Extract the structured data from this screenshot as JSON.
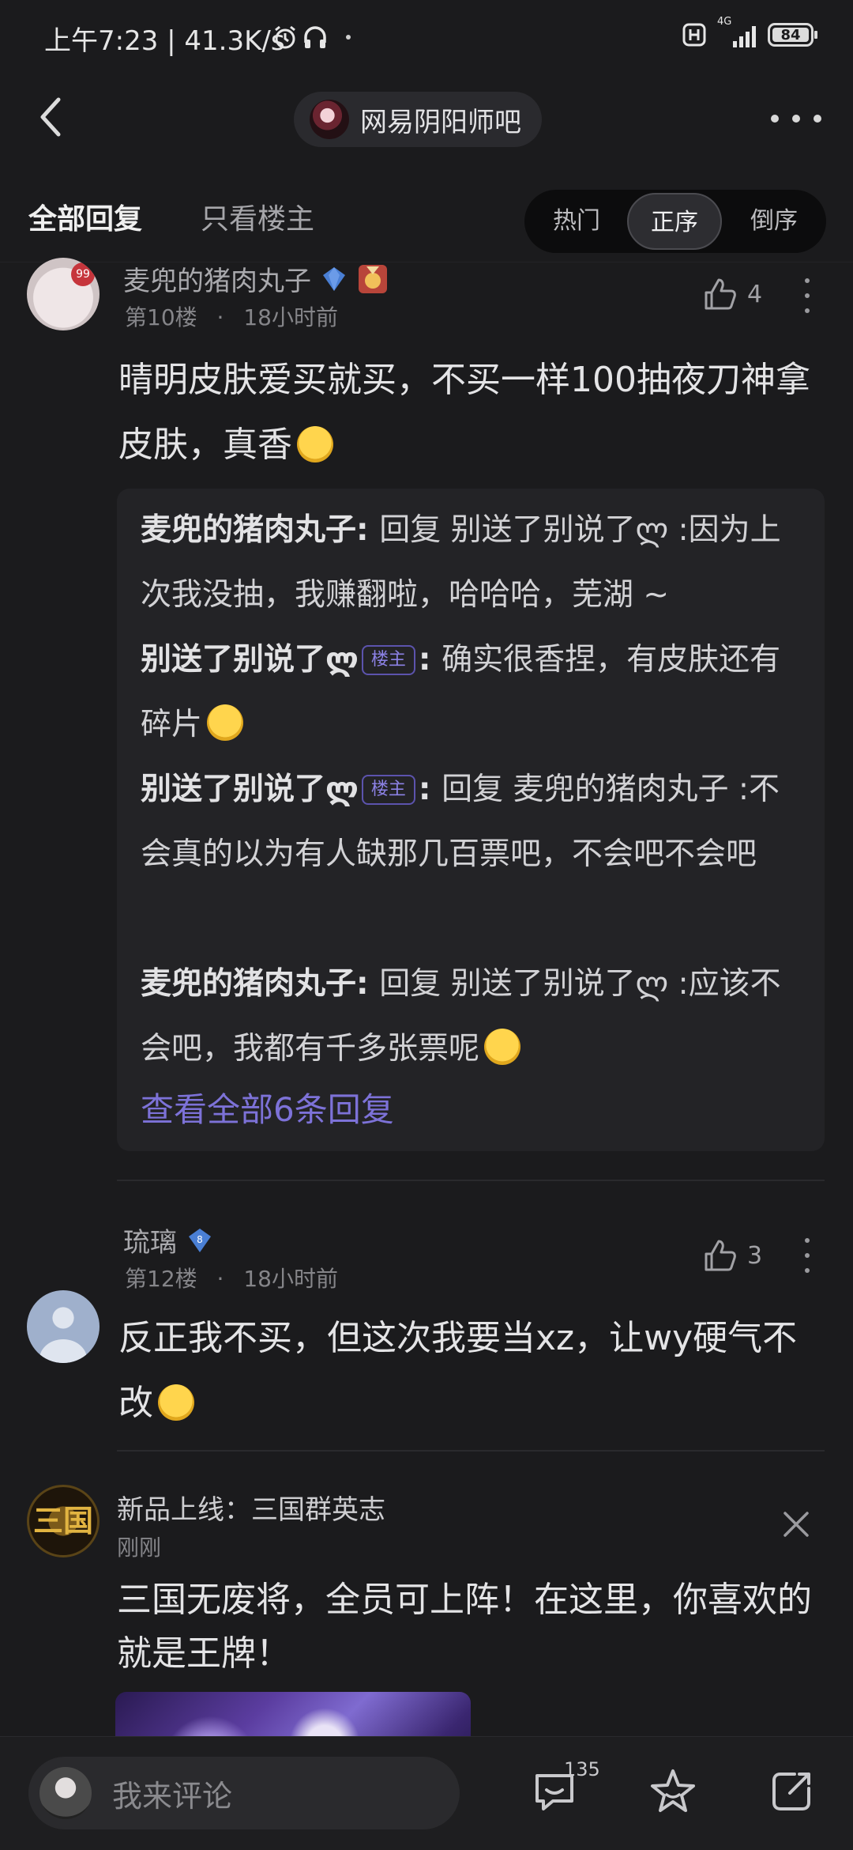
{
  "status_bar": {
    "time_speed": "上午7:23 | 41.3K/s",
    "network": "4G",
    "battery": "84"
  },
  "header": {
    "forum_name": "网易阴阳师吧"
  },
  "tabs": {
    "all_replies": "全部回复",
    "owner_only": "只看楼主",
    "sort_options": [
      "热门",
      "正序",
      "倒序"
    ],
    "active_sort": "正序"
  },
  "posts": [
    {
      "username": "麦兜的猪肉丸子",
      "avatar_badge": "99",
      "floor": "第10楼",
      "separator": "·",
      "time": "18小时前",
      "likes": "4",
      "content": "晴明皮肤爱买就买，不买一样100抽夜刀神拿皮肤，真香",
      "replies": [
        {
          "author": "麦兜的猪肉丸子",
          "is_owner": false,
          "text": "回复 别送了别说了ლ :因为上次我没抽，我赚翻啦，哈哈哈，芜湖 ~"
        },
        {
          "author": "别送了别说了ლ",
          "is_owner": true,
          "text": "确实很香捏，有皮肤还有碎片"
        },
        {
          "author": "别送了别说了ლ",
          "is_owner": true,
          "text": "回复 麦兜的猪肉丸子 :不会真的以为有人缺那几百票吧，不会吧不会吧"
        },
        {
          "author": "麦兜的猪肉丸子",
          "is_owner": false,
          "text": "回复 别送了别说了ლ :应该不会吧，我都有千多张票呢"
        }
      ],
      "owner_tag": "楼主",
      "view_all": "查看全部6条回复"
    },
    {
      "username": "琉璃",
      "level": "8",
      "floor": "第12楼",
      "separator": "·",
      "time": "18小时前",
      "likes": "3",
      "content": "反正我不买，但这次我要当xz，让wy硬气不改"
    }
  ],
  "ad": {
    "title": "新品上线：三国群英志",
    "time": "刚刚",
    "text": "三国无废将，全员可上阵！在这里，你喜欢的就是王牌！",
    "logo_text": "三国"
  },
  "bottom_bar": {
    "placeholder": "我来评论",
    "comment_count": "135"
  },
  "colors": {
    "background": "#1b1b1d",
    "link": "#7d72d8",
    "owner_tag": "#8c82e6"
  }
}
